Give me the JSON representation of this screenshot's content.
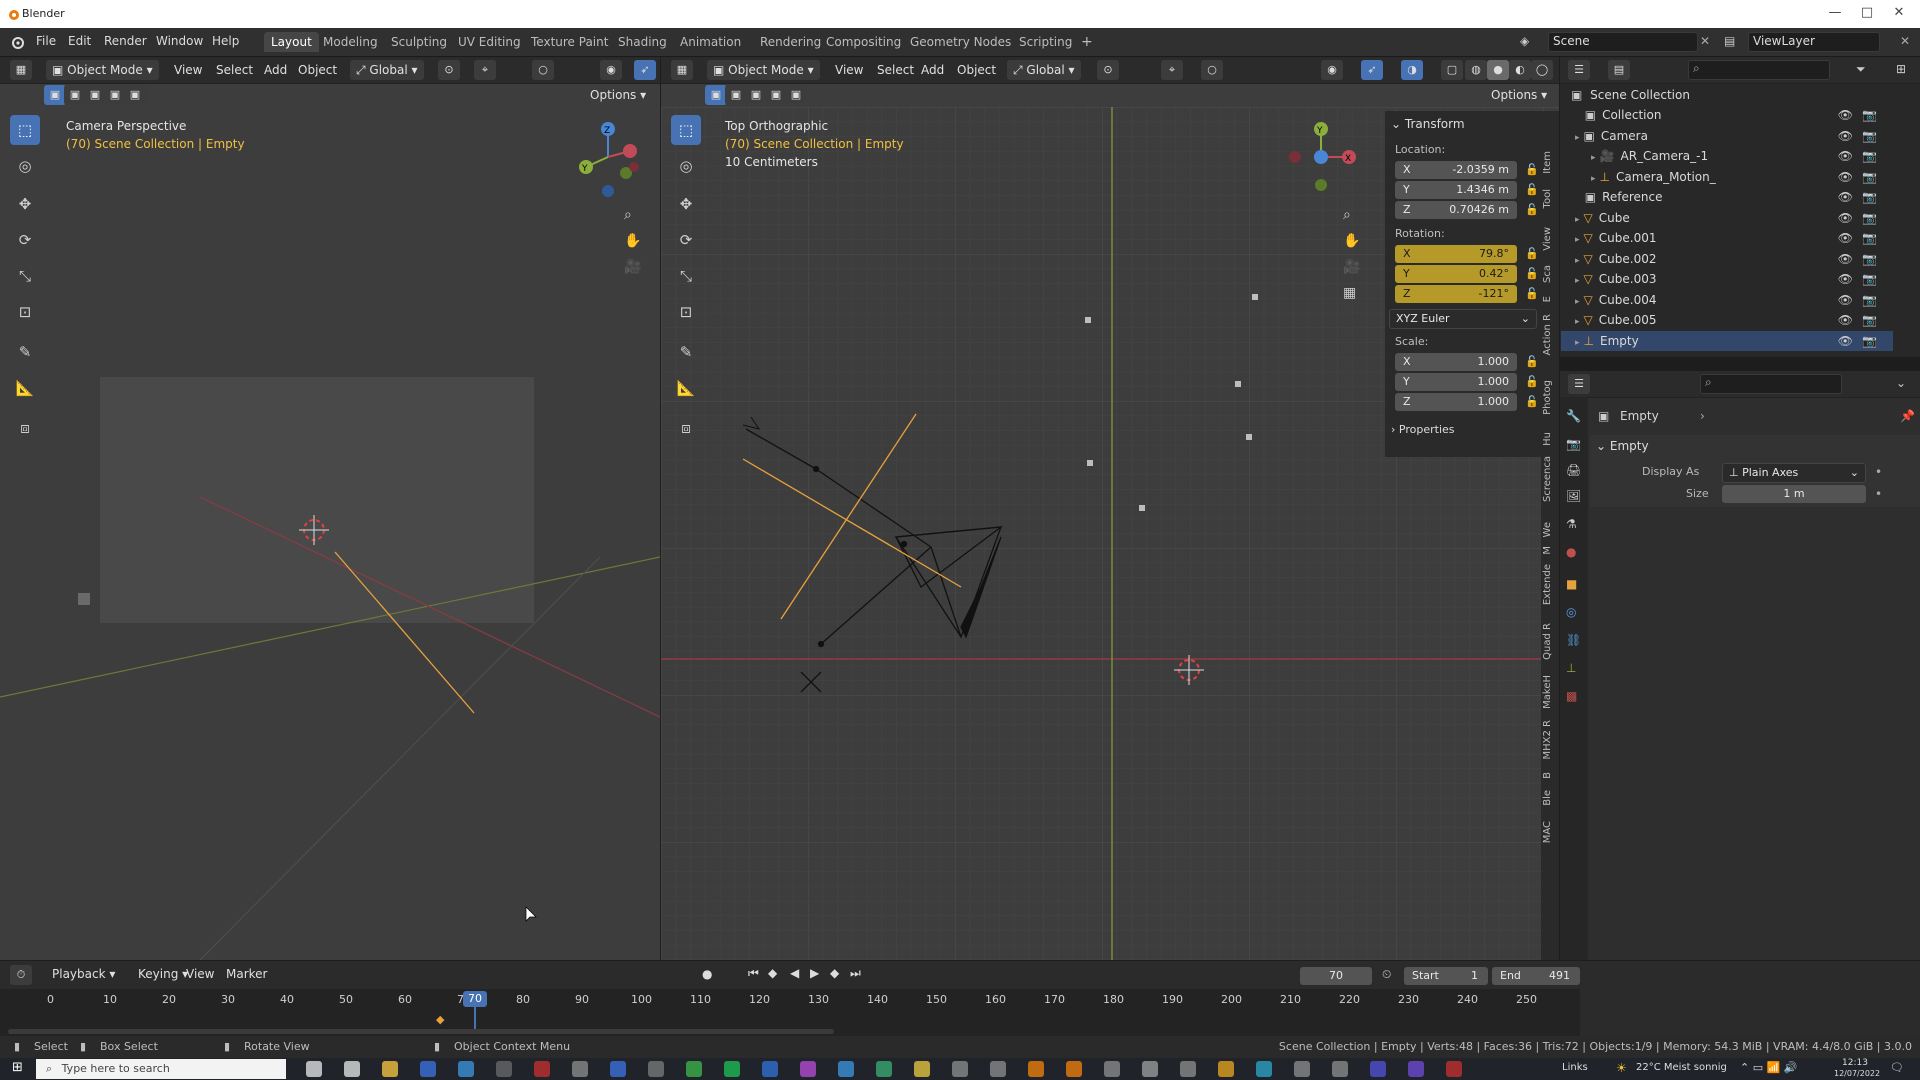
{
  "window": {
    "title": "Blender"
  },
  "menu": [
    "File",
    "Edit",
    "Render",
    "Window",
    "Help"
  ],
  "workspaces": [
    "Layout",
    "Modeling",
    "Sculpting",
    "UV Editing",
    "Texture Paint",
    "Shading",
    "Animation",
    "Rendering",
    "Compositing",
    "Geometry Nodes",
    "Scripting"
  ],
  "top_right": {
    "scene": "Scene",
    "view_layer": "ViewLayer"
  },
  "viewport_left": {
    "mode": "Object Mode",
    "menus": [
      "View",
      "Select",
      "Add",
      "Object"
    ],
    "orientation": "Global",
    "options": "Options",
    "title": "Camera Perspective",
    "subtitle": "(70) Scene Collection | Empty"
  },
  "viewport_right": {
    "mode": "Object Mode",
    "menus": [
      "View",
      "Select",
      "Add",
      "Object"
    ],
    "orientation": "Global",
    "options": "Options",
    "title": "Top Orthographic",
    "subtitle": "(70) Scene Collection | Empty",
    "scale": "10 Centimeters"
  },
  "npanel": {
    "header": "Transform",
    "location_label": "Location:",
    "location": [
      {
        "axis": "X",
        "value": "-2.0359 m"
      },
      {
        "axis": "Y",
        "value": "1.4346 m"
      },
      {
        "axis": "Z",
        "value": "0.70426 m"
      }
    ],
    "rotation_label": "Rotation:",
    "rotation": [
      {
        "axis": "X",
        "value": "79.8°"
      },
      {
        "axis": "Y",
        "value": "0.42°"
      },
      {
        "axis": "Z",
        "value": "-121°"
      }
    ],
    "rotation_mode": "XYZ Euler",
    "scale_label": "Scale:",
    "scale": [
      {
        "axis": "X",
        "value": "1.000"
      },
      {
        "axis": "Y",
        "value": "1.000"
      },
      {
        "axis": "Z",
        "value": "1.000"
      }
    ],
    "properties": "Properties",
    "tabs": [
      "Item",
      "Tool",
      "View",
      "Sca",
      "E",
      "Action R",
      "Photog",
      "Hu",
      "Screenca",
      "We",
      "M",
      "Extende",
      "Quad R",
      "MakeH",
      "MHX2 R",
      "B",
      "Ble",
      "MAC"
    ]
  },
  "outliner": {
    "root": "Scene Collection",
    "rows": [
      {
        "label": "Collection",
        "indent": 1
      },
      {
        "label": "Camera",
        "indent": 1
      },
      {
        "label": "AR_Camera_-1",
        "indent": 2
      },
      {
        "label": "Camera_Motion_",
        "indent": 2
      },
      {
        "label": "Reference",
        "indent": 1
      },
      {
        "label": "Cube",
        "indent": 1
      },
      {
        "label": "Cube.001",
        "indent": 1
      },
      {
        "label": "Cube.002",
        "indent": 1
      },
      {
        "label": "Cube.003",
        "indent": 1
      },
      {
        "label": "Cube.004",
        "indent": 1
      },
      {
        "label": "Cube.005",
        "indent": 1
      },
      {
        "label": "Empty",
        "indent": 1
      }
    ]
  },
  "properties": {
    "breadcrumb": "Empty",
    "section": "Empty",
    "display_as_label": "Display As",
    "display_as_value": "Plain Axes",
    "size_label": "Size",
    "size_value": "1 m"
  },
  "timeline": {
    "menus": [
      "Playback",
      "Keying",
      "View",
      "Marker"
    ],
    "current_frame": "70",
    "start_label": "Start",
    "start": "1",
    "end_label": "End",
    "end": "491",
    "ticks": [
      "0",
      "10",
      "20",
      "30",
      "40",
      "50",
      "60",
      "70",
      "80",
      "90",
      "100",
      "110",
      "120",
      "130",
      "140",
      "150",
      "160",
      "170",
      "180",
      "190",
      "200",
      "210",
      "220",
      "230",
      "240",
      "250"
    ]
  },
  "status": {
    "select": "Select",
    "box_select": "Box Select",
    "rotate_view": "Rotate View",
    "context_menu": "Object Context Menu",
    "stats": "Scene Collection | Empty | Verts:48 | Faces:36 | Tris:72 | Objects:1/9 | Memory: 54.3 MiB | VRAM: 4.4/8.0 GiB | 3.0.0"
  },
  "taskbar": {
    "search": "Type here to search",
    "links": "Links",
    "weather": "22°C  Meist sonnig",
    "time": "12:13",
    "date": "12/07/2022"
  },
  "colors": {
    "accent": "#4772b3",
    "selected_row": "#33476b",
    "animated_field": "#b59a2a",
    "x_axis": "#c24b57",
    "y_axis": "#8cae3a",
    "empty": "#e8a23c"
  }
}
